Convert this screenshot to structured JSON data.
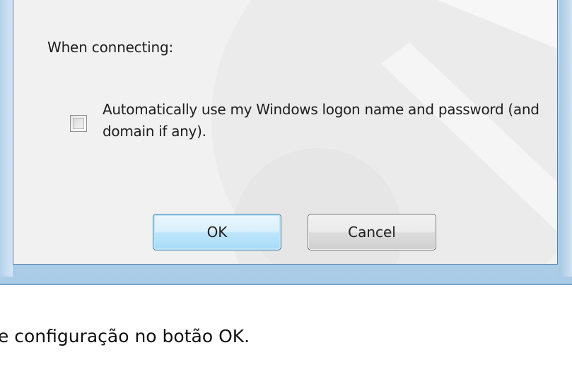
{
  "dialog": {
    "section_label": "When connecting:",
    "checkbox": {
      "label": "Automatically use my Windows logon name and password (and domain if any).",
      "checked": false
    },
    "ok_label": "OK",
    "cancel_label": "Cancel"
  },
  "caption": {
    "text": "de configuração no botão OK."
  },
  "colors": {
    "dialog_background": "#f1f1f1",
    "frame_blue": "#b9d5ec",
    "ok_border": "#3c7fb1"
  }
}
